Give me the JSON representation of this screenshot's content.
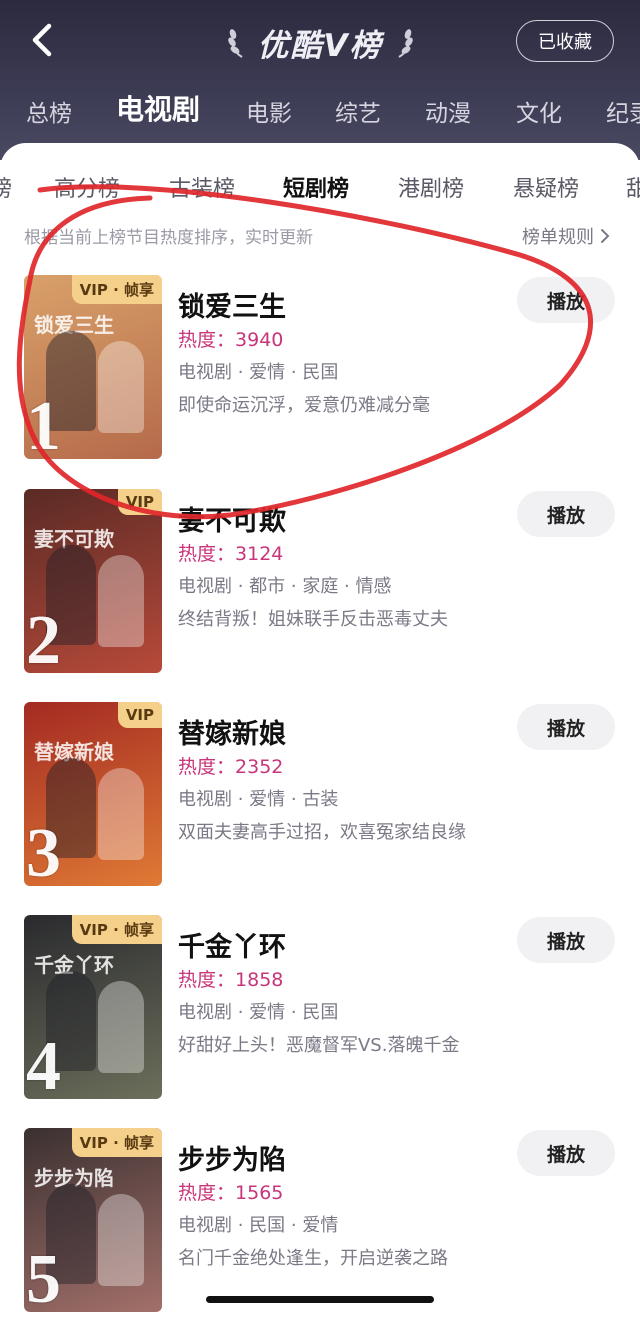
{
  "header": {
    "title": "优酷V榜",
    "favorite_label": "已收藏"
  },
  "main_tabs": [
    "总榜",
    "电视剧",
    "电影",
    "综艺",
    "动漫",
    "文化",
    "纪录"
  ],
  "sub_tabs": [
    "榜",
    "高分榜",
    "古装榜",
    "短剧榜",
    "港剧榜",
    "悬疑榜",
    "甜"
  ],
  "notice": "根据当前上榜节目热度排序，实时更新",
  "rules_label": "榜单规则",
  "heat_prefix": "热度：",
  "play_label": "播放",
  "colors": {
    "header_bg": "#3d3c55",
    "heat": "#c8357a",
    "badge": "#f5d08a",
    "annotation": "#e0262a"
  },
  "items": [
    {
      "rank": "1",
      "badge": "VIP · 帧享",
      "poster_text": "锁爱三生",
      "name": "锁爱三生",
      "heat": "3940",
      "tags": "电视剧 · 爱情 · 民国",
      "desc": "即使命运沉浮，爱意仍难减分毫",
      "poster_colors": [
        "#d9a16a",
        "#b56a4a"
      ]
    },
    {
      "rank": "2",
      "badge": "VIP",
      "poster_text": "妻不可欺",
      "name": "妻不可欺",
      "heat": "3124",
      "tags": "电视剧 · 都市 · 家庭 · 情感",
      "desc": "终结背叛！姐妹联手反击恶毒丈夫",
      "poster_colors": [
        "#5a2a25",
        "#b74a3a"
      ]
    },
    {
      "rank": "3",
      "badge": "VIP",
      "poster_text": "替嫁新娘",
      "name": "替嫁新娘",
      "heat": "2352",
      "tags": "电视剧 · 爱情 · 古装",
      "desc": "双面夫妻高手过招，欢喜冤家结良缘",
      "poster_colors": [
        "#a32a22",
        "#e07a35"
      ]
    },
    {
      "rank": "4",
      "badge": "VIP · 帧享",
      "poster_text": "千金丫环",
      "name": "千金丫环",
      "heat": "1858",
      "tags": "电视剧 · 爱情 · 民国",
      "desc": "好甜好上头！恶魔督军VS.落魄千金",
      "poster_colors": [
        "#2a2a2e",
        "#6b6f5a"
      ]
    },
    {
      "rank": "5",
      "badge": "VIP · 帧享",
      "poster_text": "步步为陷",
      "name": "步步为陷",
      "heat": "1565",
      "tags": "电视剧 · 民国 · 爱情",
      "desc": "名门千金绝处逢生，开启逆袭之路",
      "poster_colors": [
        "#3a3030",
        "#a3706a"
      ]
    }
  ]
}
